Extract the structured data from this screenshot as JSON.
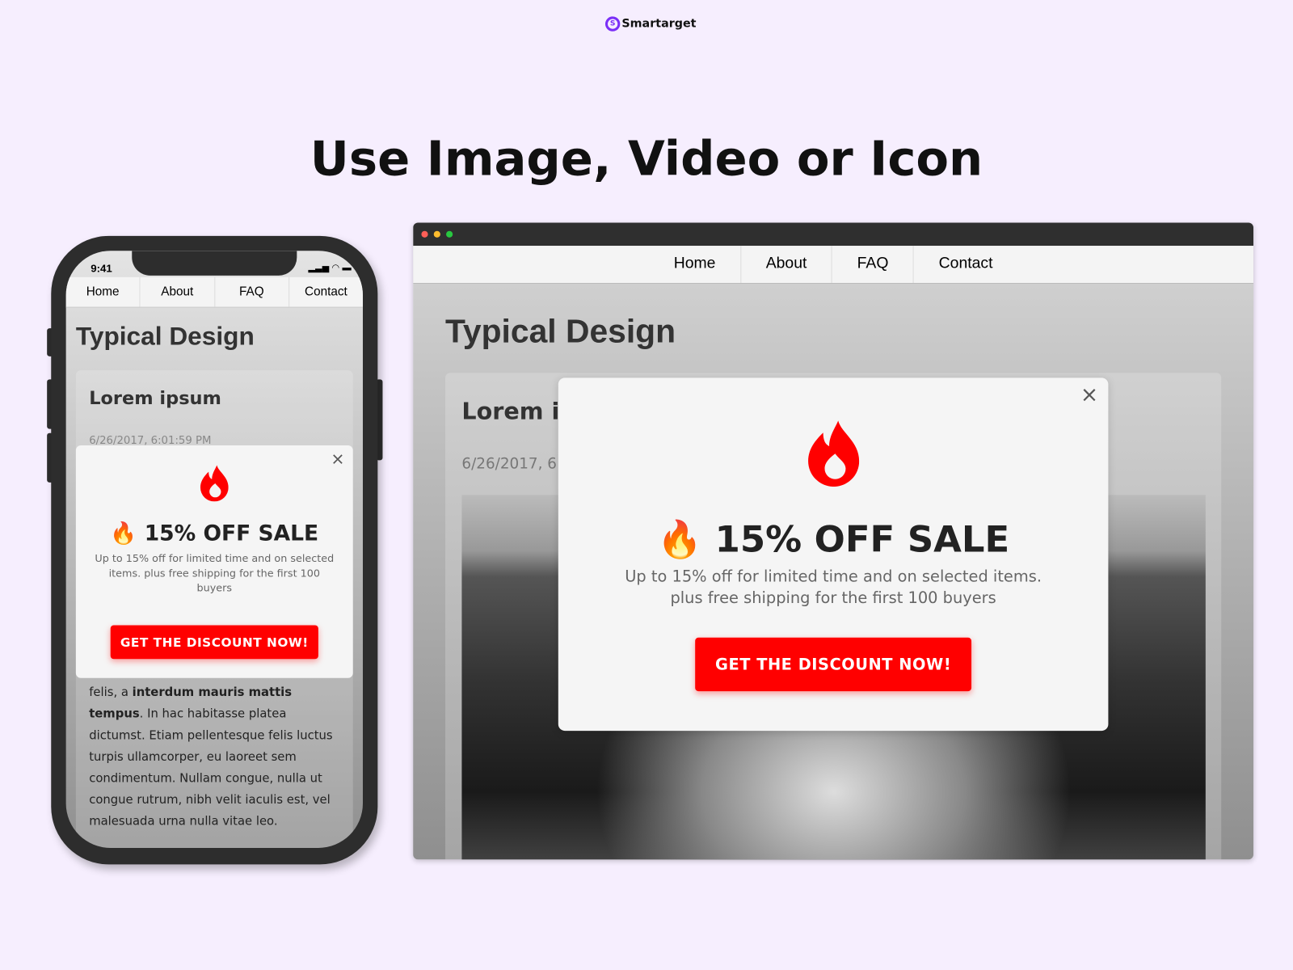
{
  "brand": {
    "name": "Smartarget",
    "logo_icon": "target-arrow-icon",
    "color": "#7b2ff7"
  },
  "headline": "Use Image, Video or Icon",
  "nav": [
    "Home",
    "About",
    "FAQ",
    "Contact"
  ],
  "phone": {
    "time": "9:41",
    "status_icons": "signal wifi battery",
    "date": "6/26/2017, 6:01:59 PM",
    "body_pre": "felis, a ",
    "body_bold": "interdum mauris mattis tempus",
    "body_post": ". In hac habitasse platea dictumst. Etiam pellentesque felis luctus turpis ullamcorper, eu laoreet sem condimentum. Nullam congue, nulla ut congue rutrum, nibh velit iaculis est, vel malesuada urna nulla vitae leo."
  },
  "browser": {
    "date": "6/26/2017, 6:"
  },
  "page": {
    "title": "Typical Design",
    "card_title": "Lorem ipsum",
    "card_title_clipped": "Lorem ip"
  },
  "popup": {
    "icon": "flame-icon",
    "sale_emoji": "🔥",
    "sale": "15% OFF SALE",
    "description": "Up to 15% off for limited time and on selected items. plus free shipping for the first 100 buyers",
    "cta": "GET THE DISCOUNT NOW!",
    "close": "×",
    "accent": "#ff0000"
  }
}
